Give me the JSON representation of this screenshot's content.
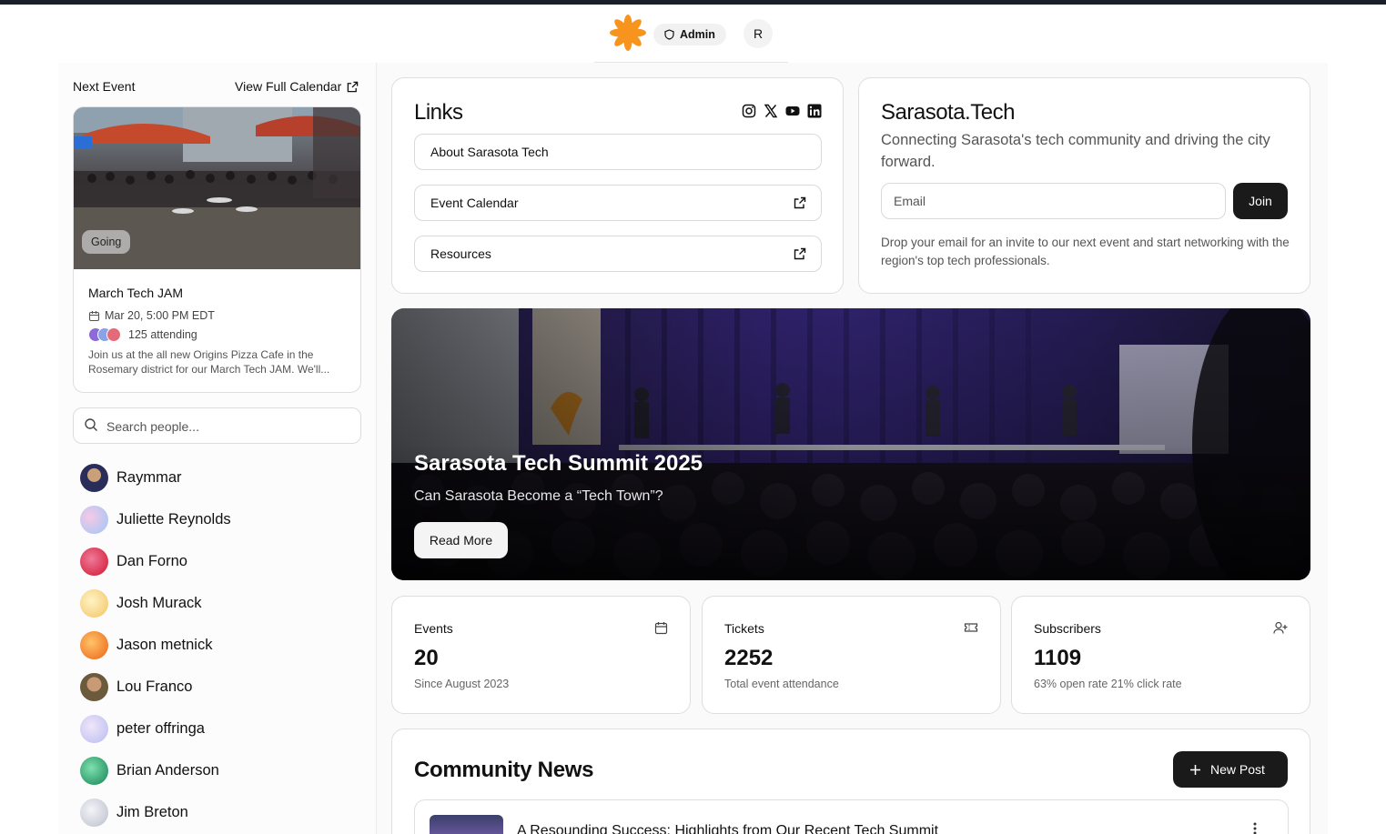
{
  "header": {
    "admin_label": "Admin",
    "user_initial": "R",
    "logo_color": "#f7941d"
  },
  "sidebar": {
    "next_event_heading": "Next Event",
    "view_calendar_label": "View Full Calendar",
    "event": {
      "status_badge": "Going",
      "title": "March Tech JAM",
      "date": "Mar 20, 5:00 PM EDT",
      "attending": "125 attending",
      "description_line1": "Join us at the all new Origins Pizza Cafe in the",
      "description_line2": "Rosemary district for our March Tech JAM. We'll..."
    },
    "search_placeholder": "Search people...",
    "people": [
      {
        "name": "Raymmar",
        "avatar": "photo"
      },
      {
        "name": "Juliette Reynolds",
        "avatar": "gradient"
      },
      {
        "name": "Dan Forno",
        "avatar": "gradient"
      },
      {
        "name": "Josh Murack",
        "avatar": "gradient"
      },
      {
        "name": "Jason metnick",
        "avatar": "gradient"
      },
      {
        "name": "Lou Franco",
        "avatar": "photo"
      },
      {
        "name": "peter offringa",
        "avatar": "gradient"
      },
      {
        "name": "Brian Anderson",
        "avatar": "gradient"
      },
      {
        "name": "Jim Breton",
        "avatar": "gradient"
      }
    ]
  },
  "links": {
    "title": "Links",
    "social_icons": [
      "instagram-icon",
      "x-icon",
      "youtube-icon",
      "linkedin-icon"
    ],
    "items": [
      {
        "label": "About Sarasota Tech",
        "external": false
      },
      {
        "label": "Event Calendar",
        "external": true
      },
      {
        "label": "Resources",
        "external": true
      }
    ]
  },
  "signup": {
    "title": "Sarasota.Tech",
    "subtitle": "Connecting Sarasota's tech community and driving the city forward.",
    "email_placeholder": "Email",
    "join_label": "Join",
    "note": "Drop your email for an invite to our next event and start networking with the region's top tech professionals."
  },
  "hero": {
    "title": "Sarasota Tech Summit 2025",
    "subtitle": "Can Sarasota Become a “Tech Town”?",
    "button_label": "Read More"
  },
  "stats": [
    {
      "label": "Events",
      "value": "20",
      "note": "Since August 2023",
      "icon": "calendar-icon"
    },
    {
      "label": "Tickets",
      "value": "2252",
      "note": "Total event attendance",
      "icon": "ticket-icon"
    },
    {
      "label": "Subscribers",
      "value": "1109",
      "note": "63% open rate 21% click rate",
      "icon": "user-plus-icon"
    }
  ],
  "news": {
    "title": "Community News",
    "new_post_label": "New Post",
    "posts": [
      {
        "title": "A Resounding Success: Highlights from Our Recent Tech Summit"
      }
    ]
  }
}
